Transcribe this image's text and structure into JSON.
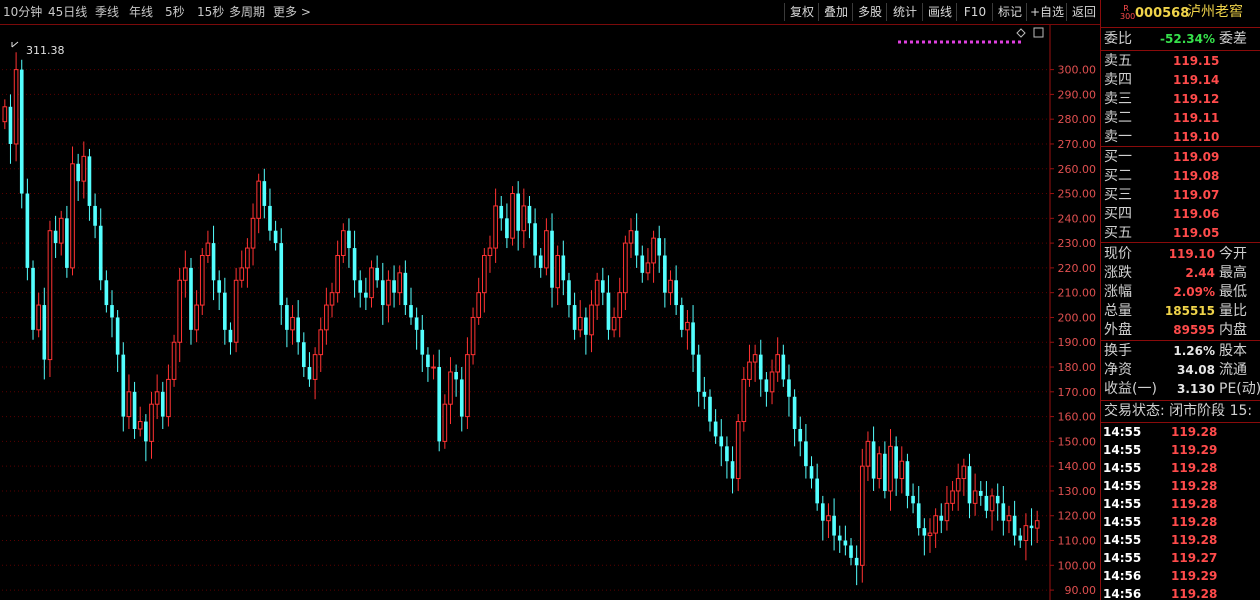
{
  "toolbar": {
    "periods": [
      "10分钟",
      "45日线",
      "季线",
      "年线",
      "5秒",
      "15秒",
      "多周期",
      "更多 >"
    ],
    "buttons": [
      "复权",
      "叠加",
      "多股",
      "统计",
      "画线",
      "F10",
      "标记",
      "+自选",
      "返回"
    ]
  },
  "stock": {
    "badge_top": "R",
    "badge_bottom": "300",
    "code": "000568",
    "name": "泸州老窖"
  },
  "quote": {
    "weibi_label": "委比",
    "weibi_value": "-52.34%",
    "weicha_label": "委差",
    "sell": [
      {
        "label": "卖五",
        "price": "119.15"
      },
      {
        "label": "卖四",
        "price": "119.14"
      },
      {
        "label": "卖三",
        "price": "119.12"
      },
      {
        "label": "卖二",
        "price": "119.11"
      },
      {
        "label": "卖一",
        "price": "119.10"
      }
    ],
    "buy": [
      {
        "label": "买一",
        "price": "119.09"
      },
      {
        "label": "买二",
        "price": "119.08"
      },
      {
        "label": "买三",
        "price": "119.07"
      },
      {
        "label": "买四",
        "price": "119.06"
      },
      {
        "label": "买五",
        "price": "119.05"
      }
    ],
    "stats": [
      {
        "label": "现价",
        "value": "119.10",
        "right": "今开",
        "color": "red"
      },
      {
        "label": "涨跌",
        "value": "2.44",
        "right": "最高",
        "color": "red"
      },
      {
        "label": "涨幅",
        "value": "2.09%",
        "right": "最低",
        "color": "red"
      },
      {
        "label": "总量",
        "value": "185515",
        "right": "量比",
        "color": "yellow"
      },
      {
        "label": "外盘",
        "value": "89595",
        "right": "内盘",
        "color": "red"
      }
    ],
    "stats2": [
      {
        "label": "换手",
        "value": "1.26%",
        "right": "股本"
      },
      {
        "label": "净资",
        "value": "34.08",
        "right": "流通"
      },
      {
        "label": "收益(一)",
        "value": "3.130",
        "right": "PE(动)"
      }
    ],
    "trade_status": "交易状态: 闭市阶段 15:",
    "ticks": [
      {
        "time": "14:55",
        "price": "119.28"
      },
      {
        "time": "14:55",
        "price": "119.29"
      },
      {
        "time": "14:55",
        "price": "119.28"
      },
      {
        "time": "14:55",
        "price": "119.28"
      },
      {
        "time": "14:55",
        "price": "119.28"
      },
      {
        "time": "14:55",
        "price": "119.28"
      },
      {
        "time": "14:55",
        "price": "119.28"
      },
      {
        "time": "14:55",
        "price": "119.27"
      },
      {
        "time": "14:56",
        "price": "119.29"
      },
      {
        "time": "14:56",
        "price": "119.28"
      }
    ]
  },
  "chart_data": {
    "type": "candlestick",
    "max_label": "311.38",
    "y_ticks": [
      300.0,
      290.0,
      280.0,
      270.0,
      260.0,
      250.0,
      240.0,
      230.0,
      220.0,
      210.0,
      200.0,
      190.0,
      180.0,
      170.0,
      160.0,
      150.0,
      140.0,
      130.0,
      120.0,
      110.0,
      100.0,
      90.0
    ],
    "ylim": [
      86,
      318
    ],
    "colors": {
      "up": "#ff3232",
      "down": "#54ffff",
      "grid": "#5a0000",
      "axis": "#9a1010"
    },
    "closes": [
      285,
      270,
      300,
      250,
      220,
      195,
      205,
      183,
      235,
      230,
      240,
      220,
      262,
      255,
      265,
      245,
      237,
      215,
      205,
      200,
      185,
      160,
      170,
      155,
      158,
      150,
      165,
      170,
      160,
      175,
      190,
      215,
      220,
      195,
      205,
      225,
      230,
      215,
      210,
      195,
      190,
      215,
      220,
      228,
      240,
      255,
      245,
      235,
      230,
      205,
      195,
      200,
      190,
      180,
      175,
      185,
      195,
      205,
      210,
      225,
      235,
      228,
      215,
      210,
      208,
      220,
      215,
      205,
      215,
      210,
      218,
      205,
      200,
      195,
      185,
      180,
      180,
      150,
      165,
      178,
      175,
      160,
      185,
      200,
      210,
      225,
      228,
      245,
      240,
      232,
      250,
      235,
      245,
      238,
      225,
      220,
      235,
      212,
      225,
      215,
      205,
      195,
      200,
      193,
      205,
      215,
      210,
      195,
      200,
      210,
      230,
      235,
      225,
      218,
      222,
      232,
      225,
      210,
      215,
      205,
      195,
      198,
      185,
      170,
      168,
      158,
      152,
      148,
      142,
      135,
      158,
      175,
      182,
      185,
      175,
      170,
      178,
      185,
      175,
      168,
      155,
      150,
      140,
      135,
      125,
      118,
      120,
      112,
      110,
      108,
      103,
      100,
      140,
      150,
      135,
      145,
      130,
      148,
      135,
      142,
      128,
      125,
      115,
      112,
      113,
      120,
      118,
      125,
      130,
      135,
      140,
      125,
      130,
      128,
      122,
      128,
      125,
      118,
      120,
      112,
      110,
      116,
      115,
      118
    ]
  }
}
